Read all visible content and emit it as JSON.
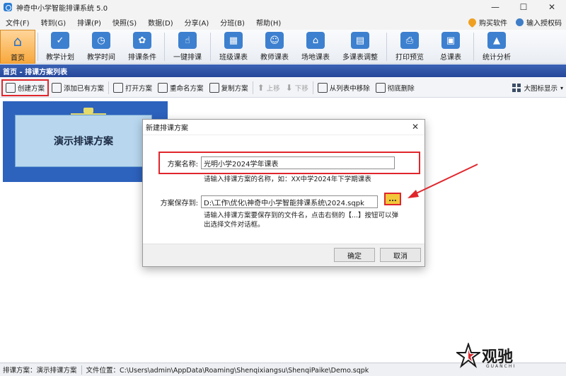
{
  "window": {
    "title": "神奇中小学智能排课系统 5.0",
    "minimize": "—",
    "maximize": "☐",
    "close": "✕"
  },
  "menu": {
    "items": [
      "文件(F)",
      "转到(G)",
      "排课(P)",
      "快照(S)",
      "数据(D)",
      "分享(A)",
      "分班(B)",
      "帮助(H)"
    ],
    "buy": "购买软件",
    "license": "输入授权码"
  },
  "ribbon": {
    "buttons": [
      {
        "label": "首页",
        "icon": "home-icon"
      },
      {
        "label": "教学计划",
        "icon": "clipboard-icon"
      },
      {
        "label": "教学时间",
        "icon": "clock-icon"
      },
      {
        "label": "排课条件",
        "icon": "conditions-icon"
      },
      {
        "label": "一键排课",
        "icon": "hand-click-icon"
      },
      {
        "label": "班级课表",
        "icon": "class-table-icon"
      },
      {
        "label": "教师课表",
        "icon": "teacher-table-icon"
      },
      {
        "label": "场地课表",
        "icon": "venue-table-icon"
      },
      {
        "label": "多课表调整",
        "icon": "multi-table-icon"
      },
      {
        "label": "打印预览",
        "icon": "printer-icon"
      },
      {
        "label": "总课表",
        "icon": "total-table-icon"
      },
      {
        "label": "统计分析",
        "icon": "chart-icon"
      }
    ]
  },
  "breadcrumb": "首页 - 排课方案列表",
  "toolbar": {
    "create": "创建方案",
    "add_existing": "添加已有方案",
    "open": "打开方案",
    "rename": "重命名方案",
    "copy": "复制方案",
    "move_up": "上移",
    "move_down": "下移",
    "remove": "从列表中移除",
    "delete": "彻底删除",
    "view_mode": "大图标显示"
  },
  "plan_card": {
    "name": "演示排课方案"
  },
  "dialog": {
    "title": "新建排课方案",
    "name_label": "方案名称:",
    "name_value": "光明小学2024学年课表",
    "name_hint": "请输入排课方案的名称，如：XX中学2024年下学期课表",
    "path_label": "方案保存到:",
    "path_value": "D:\\工作\\优化\\神奇中小学智能排课系统\\2024.sqpk",
    "browse_label": "...",
    "path_hint_1": "请输入排课方案要保存到的文件名，点击右侧的【...】按钮可以弹",
    "path_hint_2": "出选择文件对话框。",
    "ok": "确定",
    "cancel": "取消"
  },
  "status": {
    "plan": "排课方案：演示排课方案",
    "location": "文件位置：C:\\Users\\admin\\AppData\\Roaming\\Shenqixiangsu\\ShenqiPaike\\Demo.sqpk"
  },
  "watermark": {
    "text": "观驰",
    "sub": "GUANCHI"
  },
  "colors": {
    "accent": "#2d62bd",
    "highlight": "#e0262c",
    "home_tab": "#f8a83c"
  }
}
